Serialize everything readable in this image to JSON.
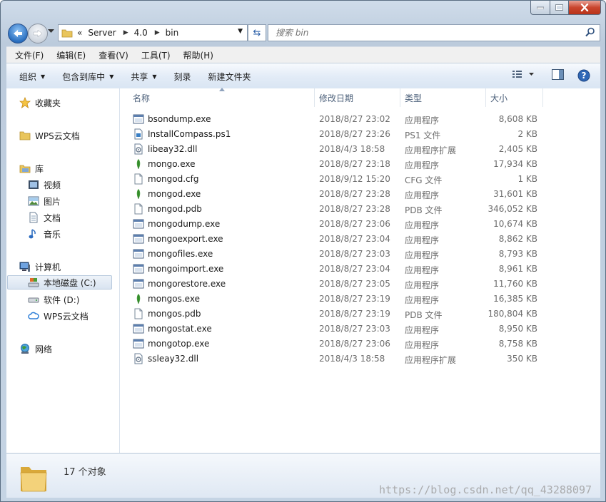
{
  "address": {
    "crumbs": [
      "«",
      "Server",
      "4.0",
      "bin"
    ],
    "search_placeholder": "搜索 bin"
  },
  "menu": [
    "文件(F)",
    "编辑(E)",
    "查看(V)",
    "工具(T)",
    "帮助(H)"
  ],
  "toolbar": {
    "organize": "组织",
    "include_library": "包含到库中",
    "share": "共享",
    "burn": "刻录",
    "new_folder": "新建文件夹"
  },
  "nav": {
    "favorites": "收藏夹",
    "wps_doc": "WPS云文档",
    "libraries": "库",
    "video": "视频",
    "pictures": "图片",
    "documents": "文档",
    "music": "音乐",
    "computer": "计算机",
    "local_disk": "本地磁盘 (C:)",
    "software_disk": "软件 (D:)",
    "wps_cloud": "WPS云文档",
    "network": "网络"
  },
  "columns": {
    "name": "名称",
    "date": "修改日期",
    "type": "类型",
    "size": "大小"
  },
  "files": [
    {
      "name": "bsondump.exe",
      "date": "2018/8/27 23:02",
      "type": "应用程序",
      "size": "8,608 KB",
      "icon": "exe-window-icon"
    },
    {
      "name": "InstallCompass.ps1",
      "date": "2018/8/27 23:26",
      "type": "PS1 文件",
      "size": "2 KB",
      "icon": "script-file-icon"
    },
    {
      "name": "libeay32.dll",
      "date": "2018/4/3 18:58",
      "type": "应用程序扩展",
      "size": "2,405 KB",
      "icon": "dll-file-icon"
    },
    {
      "name": "mongo.exe",
      "date": "2018/8/27 23:18",
      "type": "应用程序",
      "size": "17,934 KB",
      "icon": "mongo-leaf-icon"
    },
    {
      "name": "mongod.cfg",
      "date": "2018/9/12 15:20",
      "type": "CFG 文件",
      "size": "1 KB",
      "icon": "blank-file-icon"
    },
    {
      "name": "mongod.exe",
      "date": "2018/8/27 23:28",
      "type": "应用程序",
      "size": "31,601 KB",
      "icon": "mongo-leaf-icon"
    },
    {
      "name": "mongod.pdb",
      "date": "2018/8/27 23:28",
      "type": "PDB 文件",
      "size": "346,052 KB",
      "icon": "blank-file-icon"
    },
    {
      "name": "mongodump.exe",
      "date": "2018/8/27 23:06",
      "type": "应用程序",
      "size": "10,674 KB",
      "icon": "exe-window-icon"
    },
    {
      "name": "mongoexport.exe",
      "date": "2018/8/27 23:04",
      "type": "应用程序",
      "size": "8,862 KB",
      "icon": "exe-window-icon"
    },
    {
      "name": "mongofiles.exe",
      "date": "2018/8/27 23:03",
      "type": "应用程序",
      "size": "8,793 KB",
      "icon": "exe-window-icon"
    },
    {
      "name": "mongoimport.exe",
      "date": "2018/8/27 23:04",
      "type": "应用程序",
      "size": "8,961 KB",
      "icon": "exe-window-icon"
    },
    {
      "name": "mongorestore.exe",
      "date": "2018/8/27 23:05",
      "type": "应用程序",
      "size": "11,760 KB",
      "icon": "exe-window-icon"
    },
    {
      "name": "mongos.exe",
      "date": "2018/8/27 23:19",
      "type": "应用程序",
      "size": "16,385 KB",
      "icon": "mongo-leaf-icon"
    },
    {
      "name": "mongos.pdb",
      "date": "2018/8/27 23:19",
      "type": "PDB 文件",
      "size": "180,804 KB",
      "icon": "blank-file-icon"
    },
    {
      "name": "mongostat.exe",
      "date": "2018/8/27 23:03",
      "type": "应用程序",
      "size": "8,950 KB",
      "icon": "exe-window-icon"
    },
    {
      "name": "mongotop.exe",
      "date": "2018/8/27 23:06",
      "type": "应用程序",
      "size": "8,758 KB",
      "icon": "exe-window-icon"
    },
    {
      "name": "ssleay32.dll",
      "date": "2018/4/3 18:58",
      "type": "应用程序扩展",
      "size": "350 KB",
      "icon": "dll-file-icon"
    }
  ],
  "status": {
    "count": "17 个对象"
  },
  "watermark": "https://blog.csdn.net/qq_43288097"
}
